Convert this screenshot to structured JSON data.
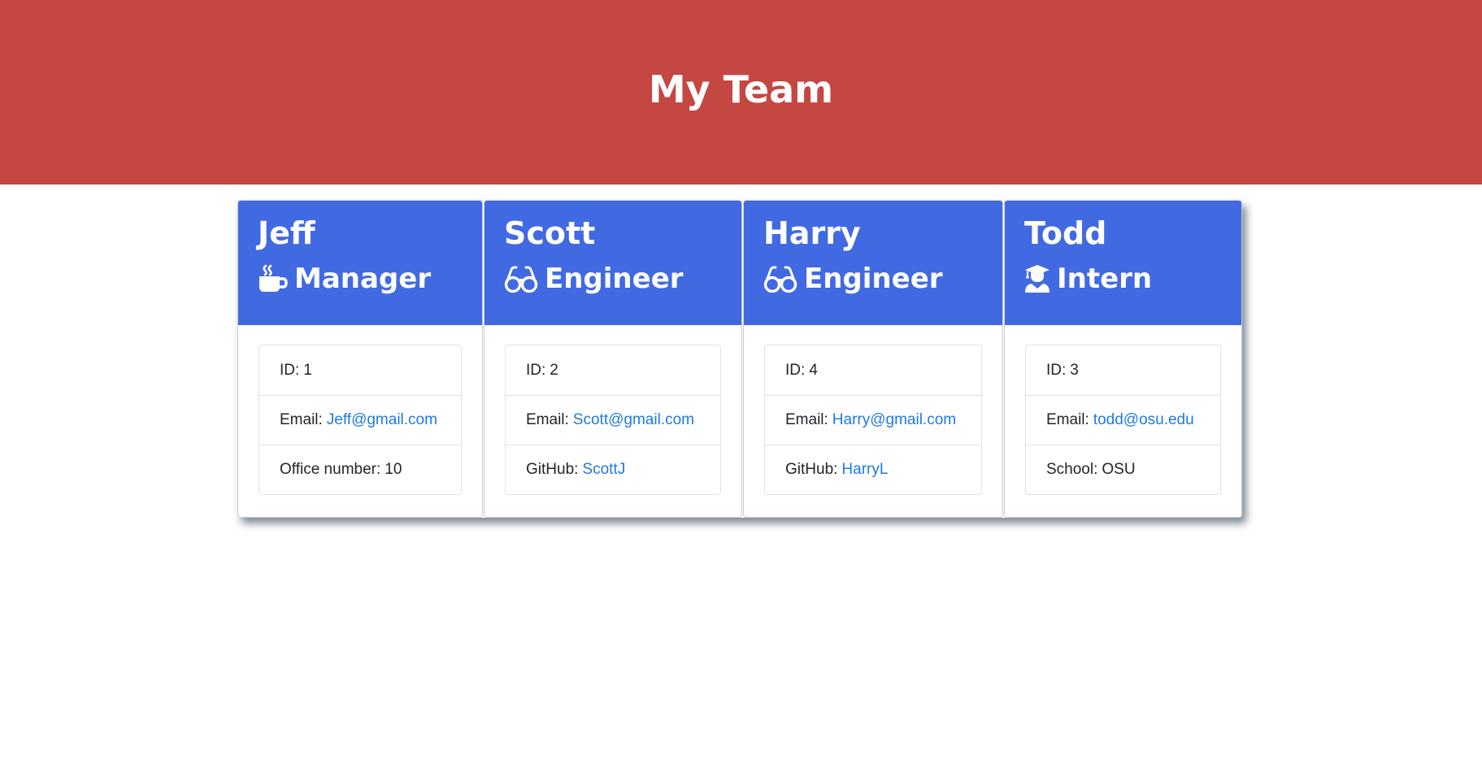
{
  "header": {
    "title": "My Team"
  },
  "colors": {
    "header_bg": "#c44742",
    "card_header_bg": "#4169e1",
    "link": "#1f7ae0"
  },
  "team": [
    {
      "name": "Jeff",
      "role": "Manager",
      "icon": "coffee-mug-icon",
      "id_label": "ID:",
      "id_value": "1",
      "email_label": "Email:",
      "email": "Jeff@gmail.com",
      "extra_label": "Office number:",
      "extra_value": "10"
    },
    {
      "name": "Scott",
      "role": "Engineer",
      "icon": "glasses-icon",
      "id_label": "ID:",
      "id_value": "2",
      "email_label": "Email:",
      "email": "Scott@gmail.com",
      "extra_label": "GitHub:",
      "extra_value": "ScottJ"
    },
    {
      "name": "Harry",
      "role": "Engineer",
      "icon": "glasses-icon",
      "id_label": "ID:",
      "id_value": "4",
      "email_label": "Email:",
      "email": "Harry@gmail.com",
      "extra_label": "GitHub:",
      "extra_value": "HarryL"
    },
    {
      "name": "Todd",
      "role": "Intern",
      "icon": "graduate-icon",
      "id_label": "ID:",
      "id_value": "3",
      "email_label": "Email:",
      "email": "todd@osu.edu",
      "extra_label": "School:",
      "extra_value": "OSU"
    }
  ]
}
